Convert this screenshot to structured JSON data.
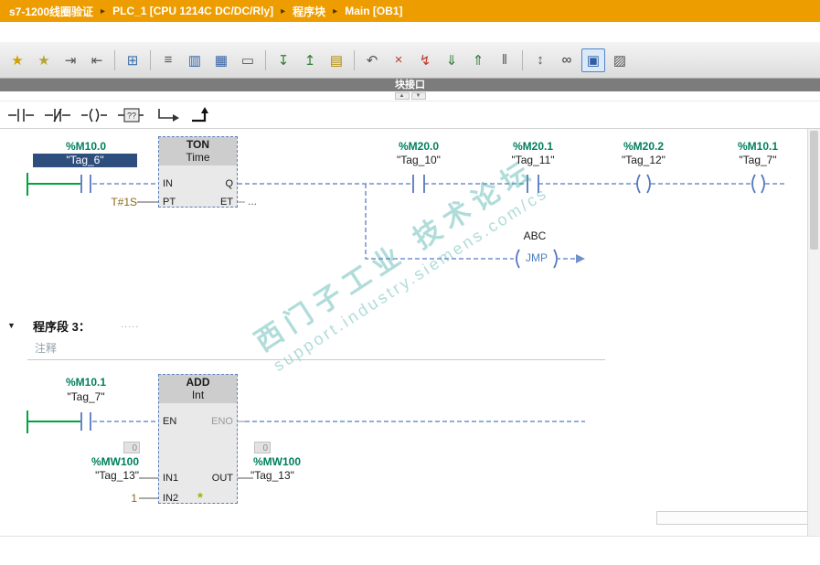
{
  "colors": {
    "titlebar_orange": "#EE9D00",
    "operand_green": "#00805C",
    "constant_brown": "#8B6914",
    "wire_green": "#00A33C",
    "wire_blue_dashed": "#7191C8",
    "selection_blue": "#2E4E7E",
    "interface_bar_gray": "#7C7C7C",
    "watermark_teal": "#2FA39B"
  },
  "titlebar": {
    "breadcrumb": [
      "s7-1200线圈验证",
      "PLC_1 [CPU 1214C DC/DC/Rly]",
      "程序块",
      "Main [OB1]"
    ],
    "separator": "▸"
  },
  "toolbar": {
    "icons": [
      {
        "name": "insert-network-icon",
        "glyph": "★",
        "color": "#D29E00"
      },
      {
        "name": "insert-empty-box-icon",
        "glyph": "★",
        "color": "#B7A437"
      },
      {
        "name": "open-branch-toolbar-icon",
        "glyph": "⇥",
        "color": "#555555"
      },
      {
        "name": "close-branch-toolbar-icon",
        "glyph": "⇤",
        "color": "#555555"
      },
      {
        "sep": true
      },
      {
        "name": "insert-box-icon",
        "glyph": "⊞",
        "color": "#3B6EA5"
      },
      {
        "sep": true
      },
      {
        "name": "align-icon",
        "glyph": "≡",
        "color": "#555555"
      },
      {
        "name": "split-editor-icon",
        "glyph": "▥",
        "color": "#2F5FA3"
      },
      {
        "name": "toggle-view-icon",
        "glyph": "▦",
        "color": "#2F5FA3"
      },
      {
        "name": "network-comment-icon",
        "glyph": "▭",
        "color": "#555555"
      },
      {
        "sep": true
      },
      {
        "name": "insert-input-icon",
        "glyph": "↧",
        "color": "#2F7D32"
      },
      {
        "name": "insert-output-icon",
        "glyph": "↥",
        "color": "#2F7D32"
      },
      {
        "name": "expand-networks-icon",
        "glyph": "▤",
        "color": "#B58900"
      },
      {
        "sep": true
      },
      {
        "name": "undo-icon",
        "glyph": "↶",
        "color": "#555555"
      },
      {
        "name": "cancel-connection-icon",
        "glyph": "×",
        "color": "#C0392B"
      },
      {
        "name": "go-offline-icon",
        "glyph": "↯",
        "color": "#C0392B"
      },
      {
        "name": "download-icon",
        "glyph": "⇓",
        "color": "#2F7D32"
      },
      {
        "name": "upload-icon",
        "glyph": "⇑",
        "color": "#2F7D32"
      },
      {
        "name": "stop-cpu-icon",
        "glyph": "‖",
        "color": "#555555"
      },
      {
        "sep": true
      },
      {
        "name": "operand-display-icon",
        "glyph": "↕",
        "color": "#555555"
      },
      {
        "name": "monitor-glasses-icon",
        "glyph": "∞",
        "color": "#333333"
      },
      {
        "name": "monitor-toggle-icon",
        "glyph": "▣",
        "color": "#2F5FA3",
        "active": true
      },
      {
        "name": "program-status-icon",
        "glyph": "▨",
        "color": "#555555"
      }
    ]
  },
  "interface_bar": {
    "label": "块接口",
    "expand_grip": "▲",
    "collapse_grip": "▼"
  },
  "favorites": {
    "empty_box_label": "??"
  },
  "ladder": {
    "network2": {
      "contact1_address": "%M10.0",
      "contact1_tag": "\"Tag_6\"",
      "timer_name": "TON",
      "timer_type": "Time",
      "pin_in": "IN",
      "pin_pt": "PT",
      "pin_q": "Q",
      "pin_et": "ET",
      "pt_value": "T#1S",
      "et_value": "...",
      "contact2_address": "%M20.0",
      "contact2_tag": "\"Tag_10\"",
      "contact3_address": "%M20.1",
      "contact3_tag": "\"Tag_11\"",
      "coil1_address": "%M20.2",
      "coil1_tag": "\"Tag_12\"",
      "coil2_address": "%M10.1",
      "coil2_tag": "\"Tag_7\"",
      "jump_label": "ABC",
      "jump_instruction": "JMP"
    },
    "network3": {
      "collapse_arrow": "▼",
      "title": "程序段 3：",
      "title_dots": ".....",
      "comment": "注释",
      "contact_address": "%M10.1",
      "contact_tag": "\"Tag_7\"",
      "block_name": "ADD",
      "block_type": "Int",
      "pin_en": "EN",
      "pin_eno": "ENO",
      "pin_in1": "IN1",
      "pin_in2": "IN2",
      "pin_out": "OUT",
      "add_input_star": "*",
      "in1_monitor": "0",
      "in1_address": "%MW100",
      "in1_tag": "\"Tag_13\"",
      "in2_value": "1",
      "out_monitor": "0",
      "out_address": "%MW100",
      "out_tag": "\"Tag_13\""
    },
    "watermark_line1": "西门子工业 技术论坛",
    "watermark_line2": "support.industry.siemens.com/cs"
  }
}
